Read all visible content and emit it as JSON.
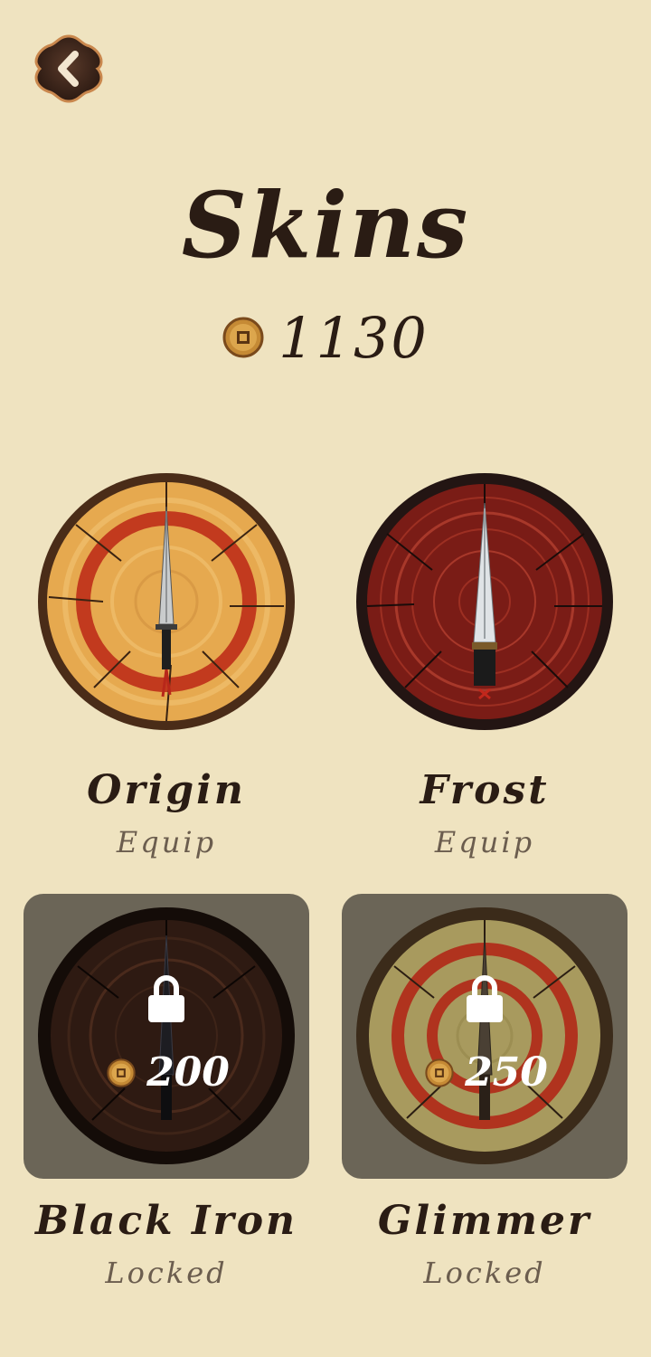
{
  "header": {
    "title": "Skins",
    "back_icon": "chevron-left-icon",
    "coin_icon": "coin-icon",
    "coin_balance": "1130"
  },
  "skins": [
    {
      "name": "Origin",
      "status": "Equip",
      "locked": false
    },
    {
      "name": "Frost",
      "status": "Equip",
      "locked": false
    },
    {
      "name": "Black Iron",
      "status": "Locked",
      "locked": true,
      "price": "200"
    },
    {
      "name": "Glimmer",
      "status": "Locked",
      "locked": true,
      "price": "250"
    }
  ],
  "colors": {
    "background": "#efe3c0",
    "text": "#2a1c14",
    "status_text": "#6b5d4e",
    "locked_panel": "#6b6557",
    "ring_red": "#c23a1e"
  }
}
